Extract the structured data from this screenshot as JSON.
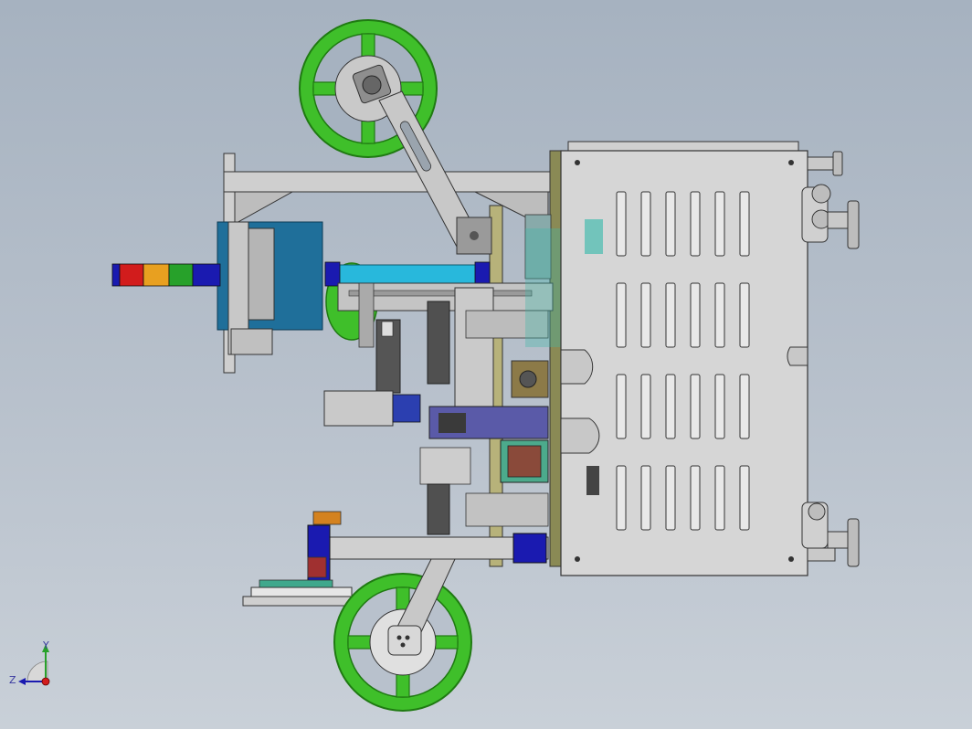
{
  "view": {
    "background_top": "#a6b2c0",
    "background_bottom": "#c9d0d8"
  },
  "colors": {
    "reel": "#3fbf2a",
    "reel_edge": "#1f7a12",
    "cabinet": "#d6d6d6",
    "motor_blue": "#1f6f9a",
    "tube_cyan": "#28b8dc",
    "rod_blue": "#1a1ab0",
    "frame_gray": "#c8c8c8"
  },
  "signal_tower": {
    "segments": [
      "blue",
      "red",
      "orange",
      "green",
      "blue"
    ]
  },
  "triad": {
    "y_label": "Y",
    "z_label": "Z"
  }
}
